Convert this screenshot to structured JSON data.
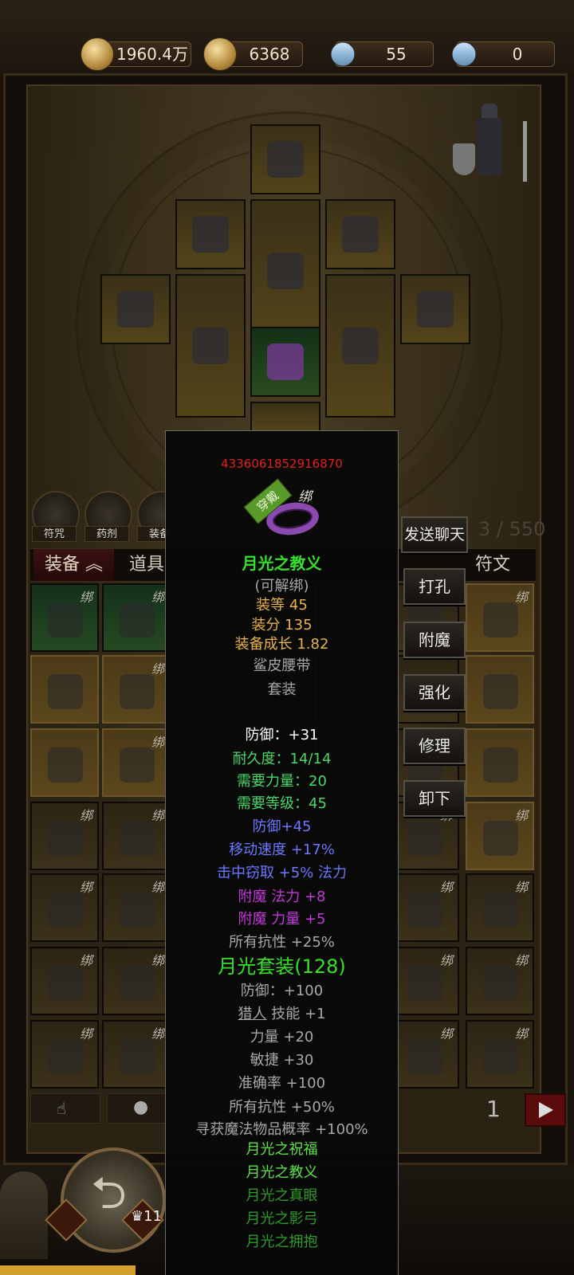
{
  "currencies": [
    {
      "icon": "gold-coin-icon",
      "value": "1960.4万"
    },
    {
      "icon": "silver-coin-icon",
      "value": "6368"
    },
    {
      "icon": "crystal-icon",
      "value": "55"
    },
    {
      "icon": "crystal-icon",
      "value": "0"
    }
  ],
  "quick_icons": [
    "符咒",
    "药剂",
    "装备"
  ],
  "tabs": [
    "装备",
    "道具",
    "符文"
  ],
  "bag_count": "3 / 550",
  "bind_label": "绑",
  "page_number": "1",
  "bottom": {
    "level_badge": "11"
  },
  "tooltip": {
    "item_id": "4336061852916870",
    "wear_tag": "穿戴",
    "bind_tag": "绑",
    "name": "月光之教义",
    "unbindable": "(可解绑)",
    "item_level": "装等 45",
    "item_score": "装分 135",
    "growth": "装备成长 1.82",
    "base_type": "鲨皮腰带",
    "set_label": "套装",
    "defense": "防御：+31",
    "durability": "耐久度：14/14",
    "req_str": "需要力量：20",
    "req_lvl": "需要等级：45",
    "mods": [
      "防御+45",
      "移动速度 +17%",
      "击中窃取 +5% 法力"
    ],
    "enchants": [
      "附魔 法力 +8",
      "附魔 力量  +5"
    ],
    "all_res": "所有抗性 +25%",
    "set_name": "月光套装(128)",
    "set_bonuses": [
      "防御：+100",
      "技能 +1",
      "力量  +20",
      "敏捷  +30",
      "准确率 +100",
      "所有抗性 +50%",
      "寻获魔法物品概率 +100%"
    ],
    "set_bonus_skill_class": "猎人",
    "set_items": [
      "月光之祝福",
      "月光之教义",
      "月光之真眼",
      "月光之影弓",
      "月光之拥抱"
    ]
  },
  "actions": {
    "send_chat": "发送聊天",
    "socket": "打孔",
    "enchant": "附魔",
    "upgrade": "强化",
    "repair": "修理",
    "unequip": "卸下"
  },
  "colors": {
    "id_red": "#e02020",
    "name_green": "#35e02a",
    "gold": "#e8b24a",
    "white": "#ffffff",
    "gray": "#a8a8a8",
    "stat_green": "#4ad76a",
    "mod_blue": "#6b78ff",
    "enchant_purple": "#c03ad8",
    "set_item_active": "#5ee04a",
    "set_item_inactive": "#2e9a2a"
  }
}
